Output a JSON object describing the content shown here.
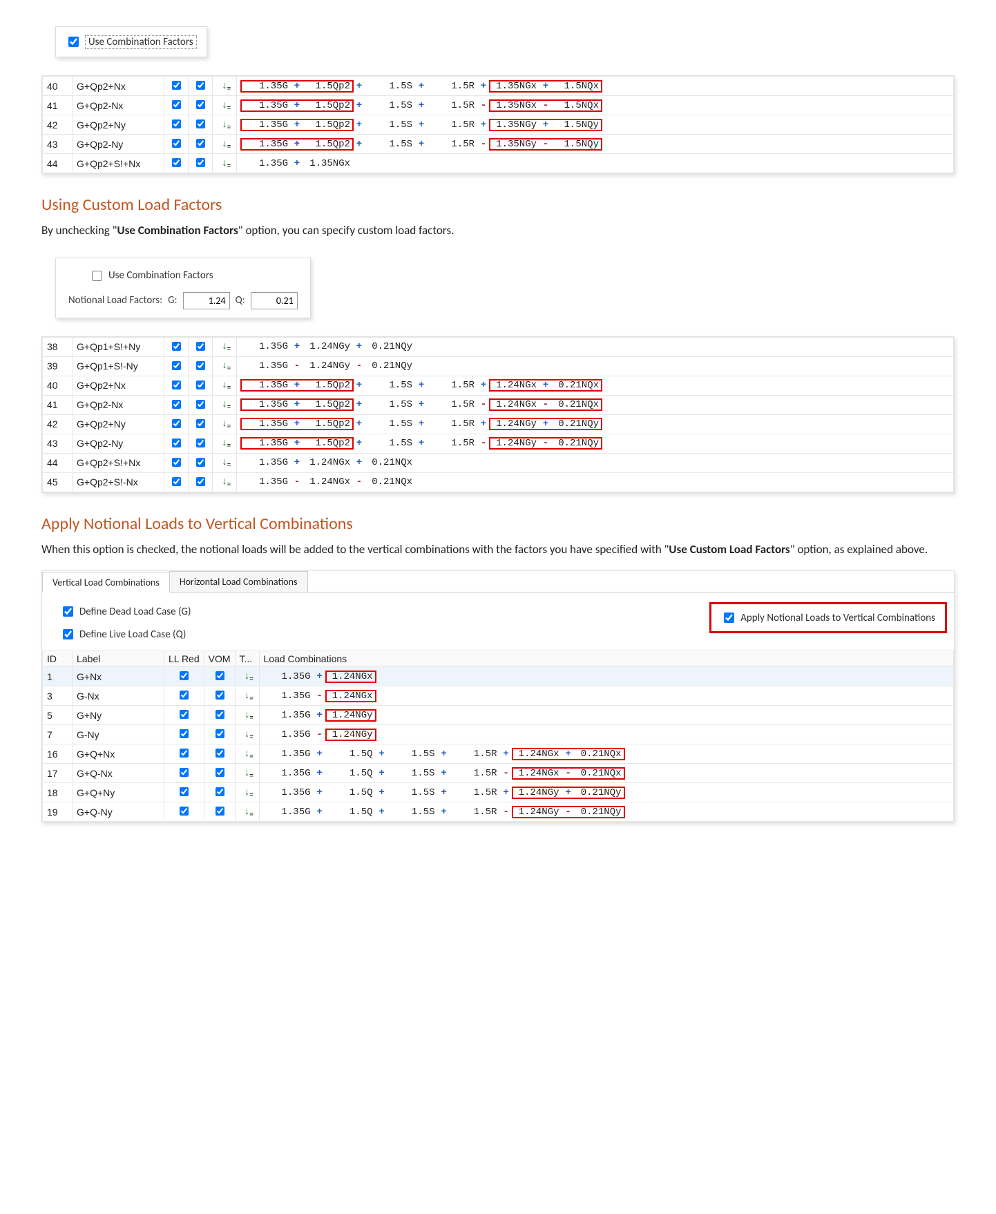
{
  "top_checkbox": {
    "label": "Use Combination Factors",
    "checked": true
  },
  "section1": {
    "heading": "Using Custom Load Factors",
    "text_pre": "By unchecking \"",
    "text_bold": "Use Combination Factors",
    "text_post": "\" option, you can specify custom load factors."
  },
  "custom_panel": {
    "checkbox_label": "Use Combination Factors",
    "checkbox_checked": false,
    "factors_label": "Notional Load Factors:",
    "g_label": "G:",
    "g_value": "1.24",
    "q_label": "Q:",
    "q_value": "0.21"
  },
  "section2": {
    "heading": "Apply Notional Loads to Vertical Combinations",
    "text_pre": "When this option is checked, the notional loads will be added to the vertical combinations with the factors you have specified with \"",
    "text_bold": "Use Custom Load Factors",
    "text_post": "\" option, as explained above."
  },
  "tabs": {
    "tab1": "Vertical Load Combinations",
    "tab2": "Horizontal Load Combinations",
    "define_dead": "Define Dead Load Case (G)",
    "define_live": "Define Live Load Case (Q)",
    "apply_notional": "Apply Notional Loads to Vertical Combinations"
  },
  "table1_rows": [
    {
      "id": "40",
      "label": "G+Qp2+Nx",
      "t": [
        "1.35G",
        "+",
        "1.5Qp2",
        "+",
        "1.5S",
        "+",
        "1.5R",
        "+",
        "1.35NGx",
        "+",
        "1.5NQx"
      ]
    },
    {
      "id": "41",
      "label": "G+Qp2-Nx",
      "t": [
        "1.35G",
        "+",
        "1.5Qp2",
        "+",
        "1.5S",
        "+",
        "1.5R",
        "-",
        "1.35NGx",
        "-",
        "1.5NQx"
      ]
    },
    {
      "id": "42",
      "label": "G+Qp2+Ny",
      "t": [
        "1.35G",
        "+",
        "1.5Qp2",
        "+",
        "1.5S",
        "+",
        "1.5R",
        "+",
        "1.35NGy",
        "+",
        "1.5NQy"
      ]
    },
    {
      "id": "43",
      "label": "G+Qp2-Ny",
      "t": [
        "1.35G",
        "+",
        "1.5Qp2",
        "+",
        "1.5S",
        "+",
        "1.5R",
        "-",
        "1.35NGy",
        "-",
        "1.5NQy"
      ]
    },
    {
      "id": "44",
      "label": "G+Qp2+S!+Nx",
      "t": [
        "1.35G",
        "+",
        "1.35NGx"
      ]
    }
  ],
  "table2_rows": [
    {
      "id": "38",
      "label": "G+Qp1+S!+Ny",
      "t": [
        "1.35G",
        "+",
        "1.24NGy",
        "+",
        "0.21NQy"
      ]
    },
    {
      "id": "39",
      "label": "G+Qp1+S!-Ny",
      "t": [
        "1.35G",
        "-",
        "1.24NGy",
        "-",
        "0.21NQy"
      ]
    },
    {
      "id": "40",
      "label": "G+Qp2+Nx",
      "t": [
        "1.35G",
        "+",
        "1.5Qp2",
        "+",
        "1.5S",
        "+",
        "1.5R",
        "+",
        "1.24NGx",
        "+",
        "0.21NQx"
      ]
    },
    {
      "id": "41",
      "label": "G+Qp2-Nx",
      "t": [
        "1.35G",
        "+",
        "1.5Qp2",
        "+",
        "1.5S",
        "+",
        "1.5R",
        "-",
        "1.24NGx",
        "-",
        "0.21NQx"
      ]
    },
    {
      "id": "42",
      "label": "G+Qp2+Ny",
      "t": [
        "1.35G",
        "+",
        "1.5Qp2",
        "+",
        "1.5S",
        "+",
        "1.5R",
        "+",
        "1.24NGy",
        "+",
        "0.21NQy"
      ]
    },
    {
      "id": "43",
      "label": "G+Qp2-Ny",
      "t": [
        "1.35G",
        "+",
        "1.5Qp2",
        "+",
        "1.5S",
        "+",
        "1.5R",
        "-",
        "1.24NGy",
        "-",
        "0.21NQy"
      ]
    },
    {
      "id": "44",
      "label": "G+Qp2+S!+Nx",
      "t": [
        "1.35G",
        "+",
        "1.24NGx",
        "+",
        "0.21NQx"
      ]
    },
    {
      "id": "45",
      "label": "G+Qp2+S!-Nx",
      "t": [
        "1.35G",
        "-",
        "1.24NGx",
        "-",
        "0.21NQx"
      ]
    }
  ],
  "table3_headers": {
    "id": "ID",
    "label": "Label",
    "llred": "LL Red",
    "vom": "VOM",
    "t": "T...",
    "comb": "Load Combinations"
  },
  "table3_rows": [
    {
      "id": "1",
      "label": "G+Nx",
      "sel": true,
      "t": [
        "1.35G",
        "+",
        "1.24NGx"
      ]
    },
    {
      "id": "3",
      "label": "G-Nx",
      "t": [
        "1.35G",
        "-",
        "1.24NGx"
      ]
    },
    {
      "id": "5",
      "label": "G+Ny",
      "t": [
        "1.35G",
        "+",
        "1.24NGy"
      ]
    },
    {
      "id": "7",
      "label": "G-Ny",
      "t": [
        "1.35G",
        "-",
        "1.24NGy"
      ]
    },
    {
      "id": "16",
      "label": "G+Q+Nx",
      "t": [
        "1.35G",
        "+",
        "1.5Q",
        "+",
        "1.5S",
        "+",
        "1.5R",
        "+",
        "1.24NGx",
        "+",
        "0.21NQx"
      ]
    },
    {
      "id": "17",
      "label": "G+Q-Nx",
      "t": [
        "1.35G",
        "+",
        "1.5Q",
        "+",
        "1.5S",
        "+",
        "1.5R",
        "-",
        "1.24NGx",
        "-",
        "0.21NQx"
      ]
    },
    {
      "id": "18",
      "label": "G+Q+Ny",
      "t": [
        "1.35G",
        "+",
        "1.5Q",
        "+",
        "1.5S",
        "+",
        "1.5R",
        "+",
        "1.24NGy",
        "+",
        "0.21NQy"
      ]
    },
    {
      "id": "19",
      "label": "G+Q-Ny",
      "t": [
        "1.35G",
        "+",
        "1.5Q",
        "+",
        "1.5S",
        "+",
        "1.5R",
        "-",
        "1.24NGy",
        "-",
        "0.21NQy"
      ]
    }
  ],
  "highlights": {
    "table1_firstcol": [
      0,
      1,
      2,
      3
    ],
    "table1_lastblock_rows": [
      0,
      1,
      2,
      3
    ],
    "table2_secondcol_rows": [
      2,
      3,
      4,
      5
    ],
    "table2_lastblock_rows": [
      2,
      3,
      4,
      5
    ],
    "table3_secondterm_rows": [
      0,
      1,
      2,
      3
    ],
    "table3_lastblock_rows": [
      4,
      5,
      6,
      7
    ]
  }
}
